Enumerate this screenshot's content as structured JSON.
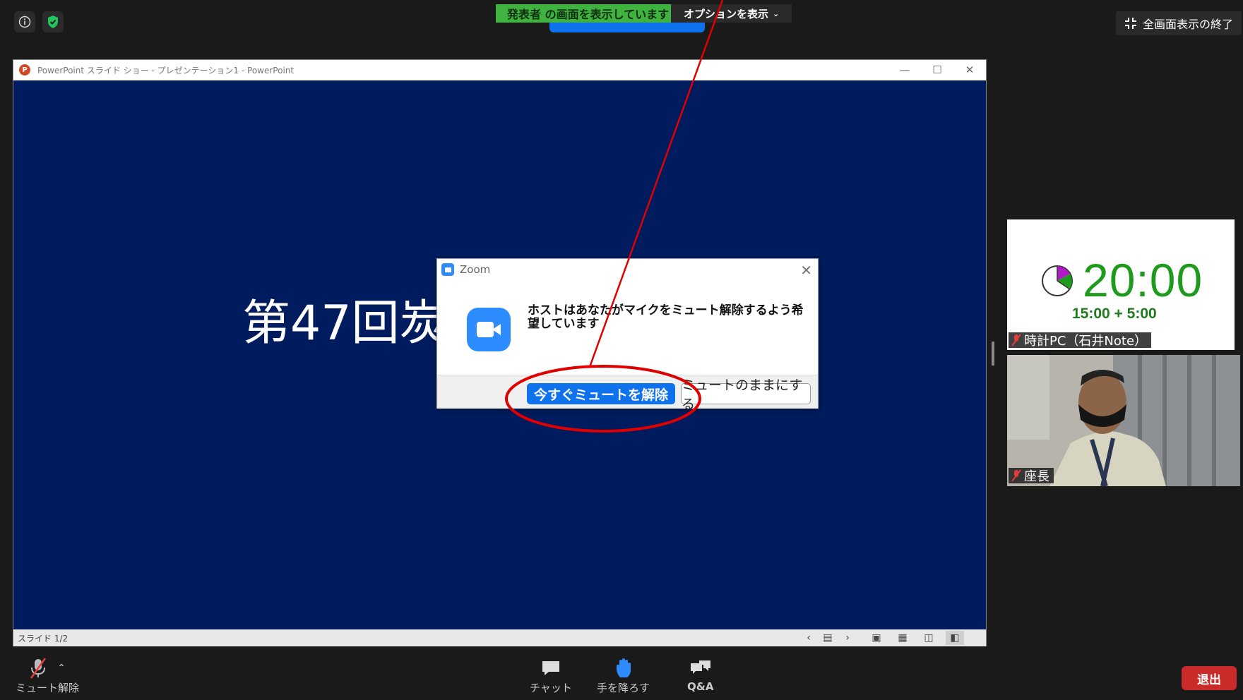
{
  "topbar": {
    "sharing_label": "発表者 の画面を表示しています",
    "options_label": "オプションを表示",
    "exit_fullscreen_label": "全画面表示の終了"
  },
  "ppt": {
    "window_title": "PowerPoint スライド ショー - プレゼンテーション1 - PowerPoint",
    "logo_letter": "P",
    "slide_title": "第47回炭",
    "status_slide": "スライド 1/2"
  },
  "dialog": {
    "title": "Zoom",
    "message": "ホストはあなたがマイクをミュート解除するよう希望しています",
    "primary_button": "今すぐミュートを解除",
    "secondary_button": "ミュートのままにする"
  },
  "participants": [
    {
      "name": "時計PC（石井Note）",
      "clock_main": "20:00",
      "clock_sub": "15:00 + 5:00"
    },
    {
      "name": "座長"
    }
  ],
  "toolbar": {
    "unmute_label": "ミュート解除",
    "chat_label": "チャット",
    "lower_hand_label": "手を降ろす",
    "qa_label": "Q&A",
    "leave_label": "退出"
  },
  "colors": {
    "zoom_blue": "#0e72ed",
    "share_green": "#3fb23f",
    "slide_bg": "#001c5e",
    "leave_red": "#c92a2a",
    "annotation_red": "#e00000"
  }
}
